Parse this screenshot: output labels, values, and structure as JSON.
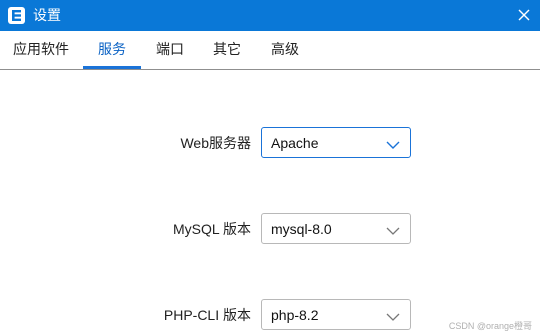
{
  "window": {
    "title": "设置",
    "icon": "app-e-logo-icon",
    "close_icon": "close-icon",
    "accent_color": "#0a78d7"
  },
  "tabs": [
    {
      "label": "应用软件",
      "active": false
    },
    {
      "label": "服务",
      "active": true
    },
    {
      "label": "端口",
      "active": false
    },
    {
      "label": "其它",
      "active": false
    },
    {
      "label": "高级",
      "active": false
    }
  ],
  "settings": {
    "web_server": {
      "label": "Web服务器",
      "value": "Apache"
    },
    "mysql": {
      "label": "MySQL 版本",
      "value": "mysql-8.0"
    },
    "php_cli": {
      "label": "PHP-CLI 版本",
      "value": "php-8.2"
    }
  },
  "watermark": "CSDN @orange橙哥"
}
